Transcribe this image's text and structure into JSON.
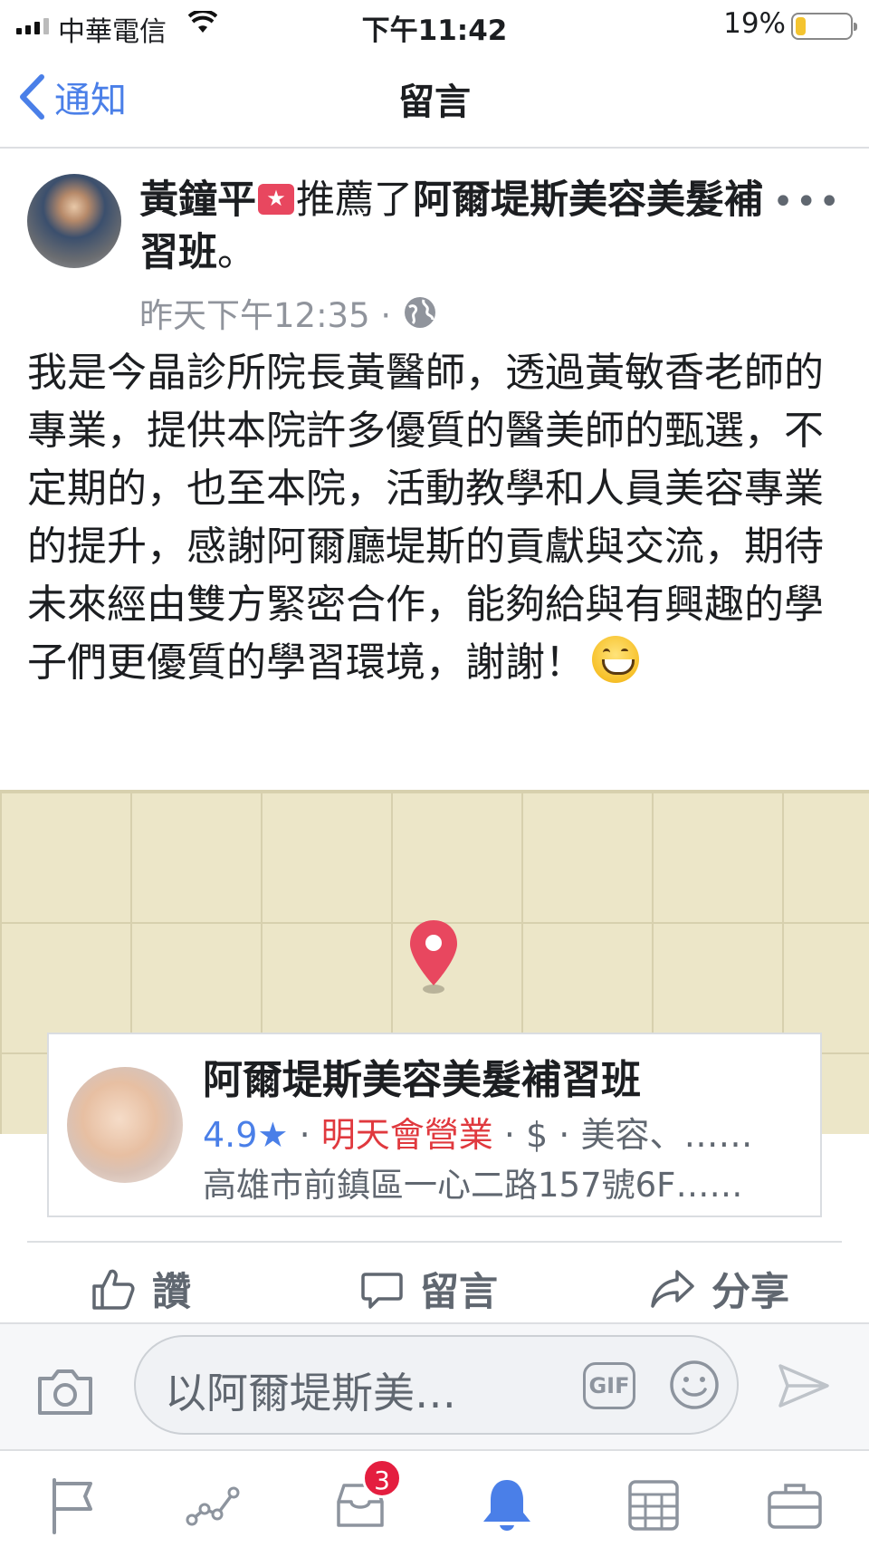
{
  "status_bar": {
    "carrier": "中華電信",
    "time": "下午11:42",
    "battery_percent": "19%",
    "battery_level": 0.19
  },
  "nav": {
    "back_label": "通知",
    "title": "留言"
  },
  "post": {
    "author": "黃鐘平",
    "action_text": "推薦了",
    "page_name": "阿爾堤斯美容美髮補習班",
    "period": "。",
    "timestamp": "昨天下午12:35 ·",
    "body": "我是今晶診所院長黃醫師，透過黃敏香老師的專業，提供本院許多優質的醫美師的甄選，不定期的，也至本院，活動教學和人員美容專業的提升，感謝阿爾廳堤斯的貢獻與交流，期待未來經由雙方緊密合作，能夠給與有興趣的學子們更優質的學習環境，謝謝！"
  },
  "place": {
    "name": "阿爾堤斯美容美髮補習班",
    "rating": "4.9★",
    "sep1": " · ",
    "open_status": "明天會營業",
    "sep2": " · ",
    "price": "$",
    "sep3": " · ",
    "category": "美容、……",
    "address": "高雄市前鎮區一心二路157號6F……"
  },
  "actions": {
    "like": "讚",
    "comment": "留言",
    "share": "分享"
  },
  "composer": {
    "placeholder": "以阿爾堤斯美…",
    "gif_label": "GIF"
  },
  "tab_bar": {
    "notifications_badge": "3"
  },
  "colors": {
    "accent_blue": "#4a7fe8",
    "badge_red": "#e41e3f",
    "open_status_red": "#e0393e",
    "map_background": "#ece6c8"
  }
}
